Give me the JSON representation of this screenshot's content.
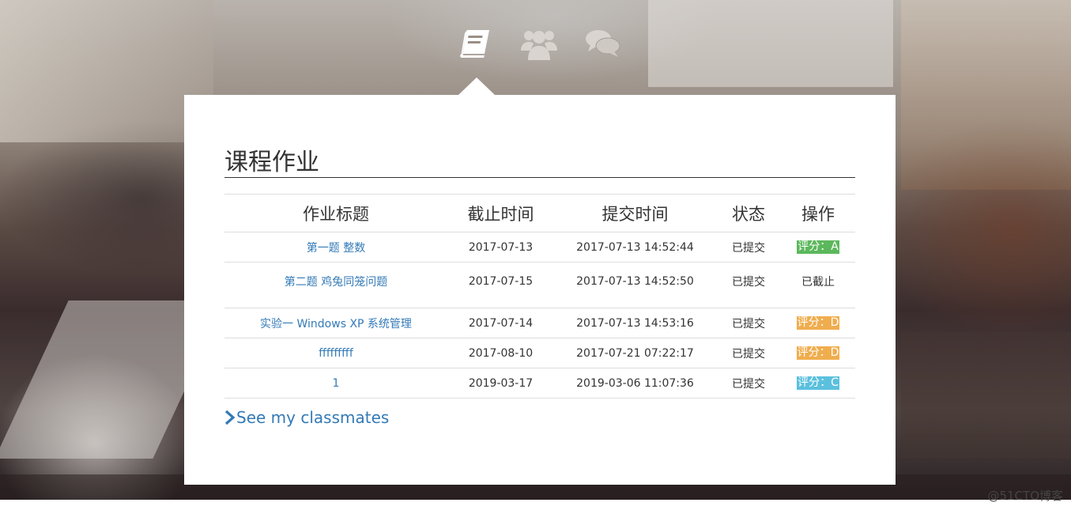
{
  "page": {
    "title": "课程作业",
    "link_label": "See my classmates",
    "watermark": "@51CTO博客"
  },
  "nav": {
    "icons": [
      "book-icon",
      "users-icon",
      "comments-icon"
    ],
    "active": "book-icon"
  },
  "table": {
    "headers": [
      "作业标题",
      "截止时间",
      "提交时间",
      "状态",
      "操作"
    ],
    "rows": [
      {
        "title": "第一题 整数",
        "due": "2017-07-13",
        "submitted": "2017-07-13 14:52:44",
        "state": "已提交",
        "action": "评分：A",
        "action_style": "grade-a"
      },
      {
        "title": "第二题 鸡兔同笼问题",
        "due": "2017-07-15",
        "submitted": "2017-07-13 14:52:50",
        "state": "已提交",
        "action": "已截止",
        "action_style": "plain"
      },
      {
        "title": "实验一 Windows XP 系统管理",
        "due": "2017-07-14",
        "submitted": "2017-07-13 14:53:16",
        "state": "已提交",
        "action": "评分：D",
        "action_style": "grade-d"
      },
      {
        "title": "fffffffff",
        "due": "2017-08-10",
        "submitted": "2017-07-21 07:22:17",
        "state": "已提交",
        "action": "评分：D",
        "action_style": "grade-d"
      },
      {
        "title": "1",
        "due": "2019-03-17",
        "submitted": "2019-03-06 11:07:36",
        "state": "已提交",
        "action": "评分：C",
        "action_style": "grade-c"
      }
    ]
  },
  "colors": {
    "link": "#337ab7",
    "grade_a": "#5cb85c",
    "grade_d": "#f0ad4e",
    "grade_c": "#5bc0de"
  }
}
